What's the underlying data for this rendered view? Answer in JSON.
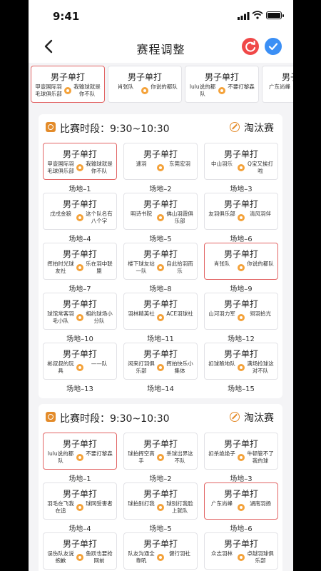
{
  "status": {
    "time": "9:41"
  },
  "nav": {
    "title": "赛程调整"
  },
  "colors": {
    "refresh": "#f04848",
    "confirm": "#3b8ff5",
    "accent": "#e38b2a",
    "highlight": "#e26565"
  },
  "match_label": "男子单打",
  "strip": [
    {
      "left": "甲壹国际羽毛球俱乐部",
      "right": "我输球就是你不队",
      "highlight": true
    },
    {
      "left": "肖张队",
      "right": "你说的都队",
      "highlight": false
    },
    {
      "left": "lulu说的都队",
      "right": "不要打黎森",
      "highlight": false
    },
    {
      "left": "广东尚峰",
      "right": "",
      "highlight": false
    }
  ],
  "sections": [
    {
      "label": "比赛时段：9:30~10:30",
      "type": "淘汰赛",
      "matches": [
        {
          "left": "甲壹国际羽毛球俱乐部",
          "right": "我输球就是你不队",
          "venue": "场地–1",
          "highlight": true
        },
        {
          "left": "速羽",
          "right": "东莞宏羽",
          "venue": "场地–2",
          "highlight": false
        },
        {
          "left": "中山羽乐",
          "right": "Q宝又挨打啦",
          "venue": "场地–3",
          "highlight": false
        },
        {
          "left": "戊戌金狼",
          "right": "这个队名有八个字",
          "venue": "场地–4",
          "highlight": false
        },
        {
          "left": "明诗书院",
          "right": "佛山羽霞俱乐部",
          "venue": "场地–5",
          "highlight": false
        },
        {
          "left": "友羽俱乐部",
          "right": "清风羽伴",
          "venue": "场地–6",
          "highlight": false
        },
        {
          "left": "挥拍时光球友社",
          "right": "乐在羽中联盟",
          "venue": "场地–7",
          "highlight": false
        },
        {
          "left": "楼下球友站一队",
          "right": "自此拾羽而乐",
          "venue": "场地–8",
          "highlight": false
        },
        {
          "left": "肖张队",
          "right": "你说的都队",
          "venue": "场地–9",
          "highlight": true
        },
        {
          "left": "球馆常客羽毛小队",
          "right": "相约球场小分队",
          "venue": "场地–10",
          "highlight": false
        },
        {
          "left": "羽林精英社",
          "right": "ACE羽球社",
          "venue": "场地–11",
          "highlight": false
        },
        {
          "left": "山河羽力军",
          "right": "翎羽拾光",
          "venue": "场地–12",
          "highlight": false
        },
        {
          "left": "彬叔叔的玩具",
          "right": "——队",
          "venue": "场地–13",
          "highlight": false
        },
        {
          "left": "闲来打羽俱乐部",
          "right": "挥拍快乐小集体",
          "venue": "场地–14",
          "highlight": false
        },
        {
          "left": "扣球跪地队",
          "right": "满场捡球这对不队",
          "venue": "场地–15",
          "highlight": false
        }
      ]
    },
    {
      "label": "比赛时段：9:30~10:30",
      "type": "淘汰赛",
      "matches": [
        {
          "left": "lulu说的都队",
          "right": "不要打黎森",
          "venue": "场地–1",
          "highlight": true
        },
        {
          "left": "球拍挥空高手",
          "right": "杀球出界这不队",
          "venue": "场地–2",
          "highlight": false
        },
        {
          "left": "扣杀绝绝子",
          "right": "牛顿管不了我的球",
          "venue": "场地–3",
          "highlight": false
        },
        {
          "left": "羽毛在飞我在追",
          "right": "球网受害者",
          "venue": "场地–4",
          "highlight": false
        },
        {
          "left": "球拍别打我",
          "right": "球别打我脸上就队",
          "venue": "场地–5",
          "highlight": false
        },
        {
          "left": "广东尚峰",
          "right": "湖南羽扬",
          "venue": "场地–6",
          "highlight": true
        },
        {
          "left": "误伤队友说抱歉",
          "right": "鱼跃也要抢网前",
          "venue": "场地–7",
          "highlight": false
        },
        {
          "left": "队友沟通全靠吼",
          "right": "健行羽社",
          "venue": "场地–8",
          "highlight": false
        },
        {
          "left": "众志羽林",
          "right": "卓越羽球俱乐部",
          "venue": "场地–9",
          "highlight": false
        }
      ]
    }
  ]
}
